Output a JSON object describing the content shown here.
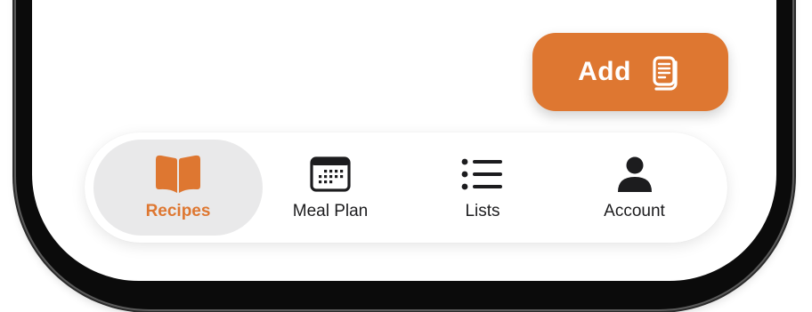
{
  "add_button": {
    "label": "Add",
    "icon": "document-icon"
  },
  "tabs": [
    {
      "label": "Recipes",
      "icon": "book-icon",
      "active": true
    },
    {
      "label": "Meal Plan",
      "icon": "calendar-icon",
      "active": false
    },
    {
      "label": "Lists",
      "icon": "list-icon",
      "active": false
    },
    {
      "label": "Account",
      "icon": "person-icon",
      "active": false
    }
  ],
  "colors": {
    "accent": "#DE7731",
    "active_tab_background": "#E9E9EA",
    "text": "#1C1C1E"
  }
}
